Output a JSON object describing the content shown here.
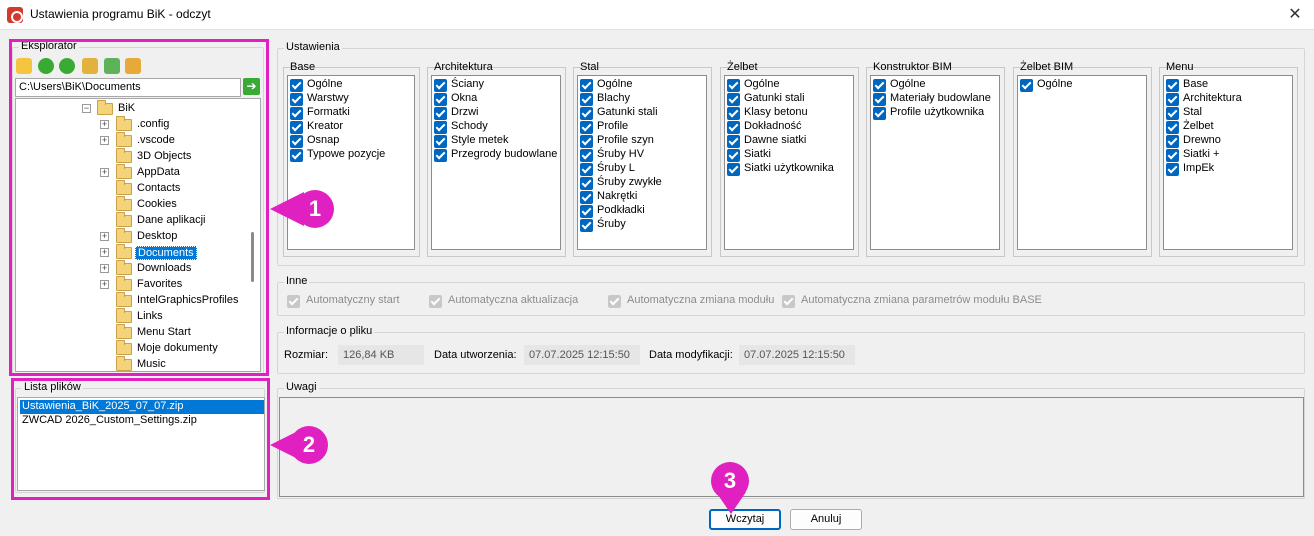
{
  "window": {
    "title": "Ustawienia programu BiK - odczyt",
    "close_glyph": "✕"
  },
  "explorer": {
    "title": "Eksplorator",
    "toolbar_icons": [
      "new-folder-icon",
      "back-icon",
      "forward-icon",
      "up-folder-icon",
      "refresh-icon",
      "home-icon"
    ],
    "path": "C:\\Users\\BiK\\Documents",
    "go_glyph": "➔",
    "tree": {
      "root": "BiK",
      "items": [
        {
          "label": ".config",
          "expandable": true
        },
        {
          "label": ".vscode",
          "expandable": true
        },
        {
          "label": "3D Objects",
          "expandable": false
        },
        {
          "label": "AppData",
          "expandable": true
        },
        {
          "label": "Contacts",
          "expandable": false
        },
        {
          "label": "Cookies",
          "expandable": false
        },
        {
          "label": "Dane aplikacji",
          "expandable": false
        },
        {
          "label": "Desktop",
          "expandable": true
        },
        {
          "label": "Documents",
          "expandable": true,
          "selected": true
        },
        {
          "label": "Downloads",
          "expandable": true
        },
        {
          "label": "Favorites",
          "expandable": true
        },
        {
          "label": "IntelGraphicsProfiles",
          "expandable": false
        },
        {
          "label": "Links",
          "expandable": false
        },
        {
          "label": "Menu Start",
          "expandable": false
        },
        {
          "label": "Moje dokumenty",
          "expandable": false
        },
        {
          "label": "Music",
          "expandable": false
        }
      ]
    }
  },
  "files": {
    "title": "Lista plików",
    "items": [
      {
        "label": "Ustawienia_BiK_2025_07_07.zip",
        "selected": true
      },
      {
        "label": "ZWCAD 2026_Custom_Settings.zip",
        "selected": false
      }
    ]
  },
  "settings": {
    "title": "Ustawienia",
    "sections": [
      {
        "title": "Base",
        "items": [
          "Ogólne",
          "Warstwy",
          "Formatki",
          "Kreator",
          "Osnap",
          "Typowe pozycje"
        ]
      },
      {
        "title": "Architektura",
        "items": [
          "Ściany",
          "Okna",
          "Drzwi",
          "Schody",
          "Style metek",
          "Przegrody budowlane"
        ]
      },
      {
        "title": "Stal",
        "items": [
          "Ogólne",
          "Blachy",
          "Gatunki stali",
          "Profile",
          "Profile szyn",
          "Śruby HV",
          "Śruby L",
          "Śruby zwykłe",
          "Nakrętki",
          "Podkładki",
          "Śruby"
        ]
      },
      {
        "title": "Żelbet",
        "items": [
          "Ogólne",
          "Gatunki stali",
          "Klasy betonu",
          "Dokładność",
          "Dawne siatki",
          "Siatki",
          "Siatki użytkownika"
        ]
      },
      {
        "title": "Konstruktor BIM",
        "items": [
          "Ogólne",
          "Materiały budowlane",
          "Profile użytkownika"
        ]
      },
      {
        "title": "Żelbet BIM",
        "items": [
          "Ogólne"
        ]
      },
      {
        "title": "Menu",
        "items": [
          "Base",
          "Architektura",
          "Stal",
          "Żelbet",
          "Drewno",
          "Siatki +",
          "ImpEk"
        ]
      }
    ]
  },
  "other": {
    "title": "Inne",
    "options": [
      "Automatyczny start",
      "Automatyczna aktualizacja",
      "Automatyczna zmiana modułu",
      "Automatyczna zmiana parametrów modułu BASE"
    ]
  },
  "file_info": {
    "title": "Informacje o pliku",
    "size_label": "Rozmiar:",
    "size_value": "126,84 KB",
    "created_label": "Data utworzenia:",
    "created_value": "07.07.2025 12:15:50",
    "modified_label": "Data modyfikacji:",
    "modified_value": "07.07.2025 12:15:50"
  },
  "notes": {
    "title": "Uwagi"
  },
  "buttons": {
    "load": "Wczytaj",
    "cancel": "Anuluj"
  },
  "callouts": [
    "1",
    "2",
    "3"
  ],
  "colors": {
    "highlight": "#e020c0",
    "selection": "#0078d7",
    "checkbox": "#0067c0"
  }
}
